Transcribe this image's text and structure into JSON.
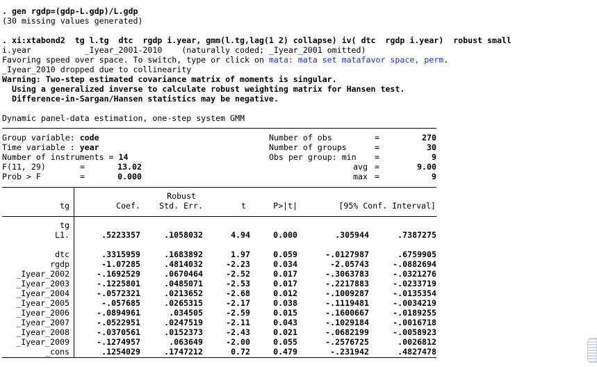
{
  "console": {
    "cmd1": ". gen rgdp=(gdp-L.gdp)/L.gdp",
    "cmd1_note": "(30 missing values generated)",
    "cmd2": ". xi:xtabond2  tg l.tg  dtc  rgdp i.year, gmm(l.tg,lag(1 2) collapse) iv( dtc  rgdp i.year)  robust small",
    "xi_line": "i.year           _Iyear_2001-2010    (naturally coded; _Iyear_2001 omitted)",
    "favor_prefix": "Favoring speed over space. To switch, type or click on ",
    "favor_link": "mata: mata set matafavor space, perm",
    "favor_suffix": ".",
    "dropped": "_Iyear_2010 dropped due to collinearity",
    "warn1": "Warning: Two-step estimated covariance matrix of moments is singular.",
    "warn2": "  Using a generalized inverse to calculate robust weighting matrix for Hansen test.",
    "warn3": "  Difference-in-Sargan/Hansen statistics may be negative.",
    "est_title": "Dynamic panel-data estimation, one-step system GMM"
  },
  "header": {
    "group_label": "Group variable: ",
    "group_value": "code",
    "time_label": "Time variable : ",
    "time_value": "year",
    "ninst_label": "Number of instruments = ",
    "ninst_value": "14",
    "f_label": "F(11, 29)",
    "f_eq": "=",
    "f_value": "13.02",
    "prob_label": "Prob > F",
    "prob_eq": "=",
    "prob_value": "0.000",
    "nobs_label": "Number of obs",
    "nobs_value": "270",
    "ngroups_label": "Number of groups",
    "ngroups_value": "30",
    "obs_min_label": "Obs per group: min",
    "obs_min_value": "9",
    "obs_avg_label": "avg",
    "obs_avg_value": "9.00",
    "obs_max_label": "max",
    "obs_max_value": "9",
    "eq": "="
  },
  "table": {
    "depvar": "tg",
    "col_robust": "Robust",
    "col_coef": "Coef.",
    "col_se": "Std. Err.",
    "col_t": "t",
    "col_p": "P>|t|",
    "col_ci": "[95% Conf. Interval]",
    "group_tg": "tg",
    "rows": [
      {
        "name": "L1.",
        "coef": ".5223357",
        "se": ".1058032",
        "t": "4.94",
        "p": "0.000",
        "lo": ".305944",
        "hi": ".7387275"
      },
      {
        "name": "dtc",
        "coef": ".3315959",
        "se": ".1683892",
        "t": "1.97",
        "p": "0.059",
        "lo": "-.0127987",
        "hi": ".6759905"
      },
      {
        "name": "rgdp",
        "coef": "-1.07285",
        "se": ".4814032",
        "t": "-2.23",
        "p": "0.034",
        "lo": "-2.05743",
        "hi": "-.0882694"
      },
      {
        "name": "_Iyear_2002",
        "coef": "-.1692529",
        "se": ".0670464",
        "t": "-2.52",
        "p": "0.017",
        "lo": "-.3063783",
        "hi": "-.0321276"
      },
      {
        "name": "_Iyear_2003",
        "coef": "-.1225801",
        "se": ".0485071",
        "t": "-2.53",
        "p": "0.017",
        "lo": "-.2217883",
        "hi": "-.0233719"
      },
      {
        "name": "_Iyear_2004",
        "coef": "-.0572321",
        "se": ".0213652",
        "t": "-2.68",
        "p": "0.012",
        "lo": "-.1009287",
        "hi": "-.0135354"
      },
      {
        "name": "_Iyear_2005",
        "coef": "-.057685",
        "se": ".0265315",
        "t": "-2.17",
        "p": "0.038",
        "lo": "-.1119481",
        "hi": "-.0034219"
      },
      {
        "name": "_Iyear_2006",
        "coef": "-.0894961",
        "se": ".034505",
        "t": "-2.59",
        "p": "0.015",
        "lo": "-.1600667",
        "hi": "-.0189255"
      },
      {
        "name": "_Iyear_2007",
        "coef": "-.0522951",
        "se": ".0247519",
        "t": "-2.11",
        "p": "0.043",
        "lo": "-.1029184",
        "hi": "-.0016718"
      },
      {
        "name": "_Iyear_2008",
        "coef": "-.0370561",
        "se": ".0152373",
        "t": "-2.43",
        "p": "0.021",
        "lo": "-.0682199",
        "hi": "-.0058923"
      },
      {
        "name": "_Iyear_2009",
        "coef": "-.1274957",
        "se": ".063649",
        "t": "-2.00",
        "p": "0.055",
        "lo": "-.2576725",
        "hi": ".0026812"
      },
      {
        "name": "_cons",
        "coef": ".1254029",
        "se": ".1747212",
        "t": "0.72",
        "p": "0.479",
        "lo": "-.231942",
        "hi": ".4827478"
      }
    ]
  }
}
